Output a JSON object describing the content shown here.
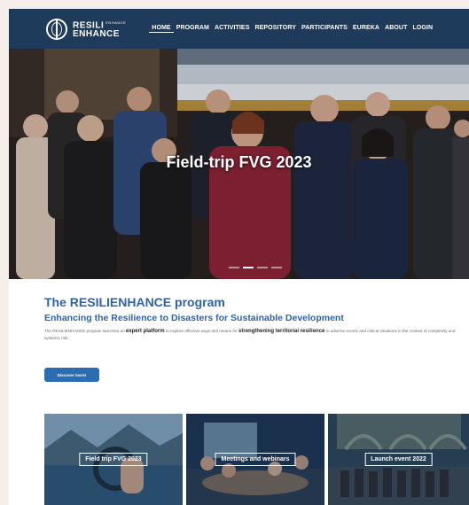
{
  "brand": {
    "line1": "RESILI",
    "line1_small": "ENHANCE",
    "line2": "ENHANCE"
  },
  "nav": {
    "items": [
      {
        "label": "HOME",
        "active": true
      },
      {
        "label": "PROGRAM"
      },
      {
        "label": "ACTIVITIES"
      },
      {
        "label": "REPOSITORY"
      },
      {
        "label": "PARTICIPANTS"
      },
      {
        "label": "EUREKA"
      },
      {
        "label": "ABOUT"
      },
      {
        "label": "LOGIN"
      }
    ]
  },
  "hero": {
    "caption": "Field-trip FVG 2023",
    "slides": 4,
    "active_slide": 1
  },
  "intro": {
    "title": "The RESILIENHANCE program",
    "subtitle": "Enhancing the Resilience to Disasters for Sustainable Development",
    "text_a": "The RESILIENHANCE program launches an ",
    "text_b": "expert platform",
    "text_c": " to explore effective ways and means for ",
    "text_d": "strengthening territorial resilience",
    "text_e": " to adverse events and critical situations in the context of complexity and systemic risk.",
    "button": "Discover more!"
  },
  "cards": [
    {
      "label": "Field trip FVG 2023"
    },
    {
      "label": "Meetings and webinars"
    },
    {
      "label": "Launch event 2022"
    }
  ],
  "colors": {
    "header": "#1f3b5c",
    "accent": "#2a64b0",
    "button": "#2a6db3",
    "page_bg": "#f6eee8"
  }
}
